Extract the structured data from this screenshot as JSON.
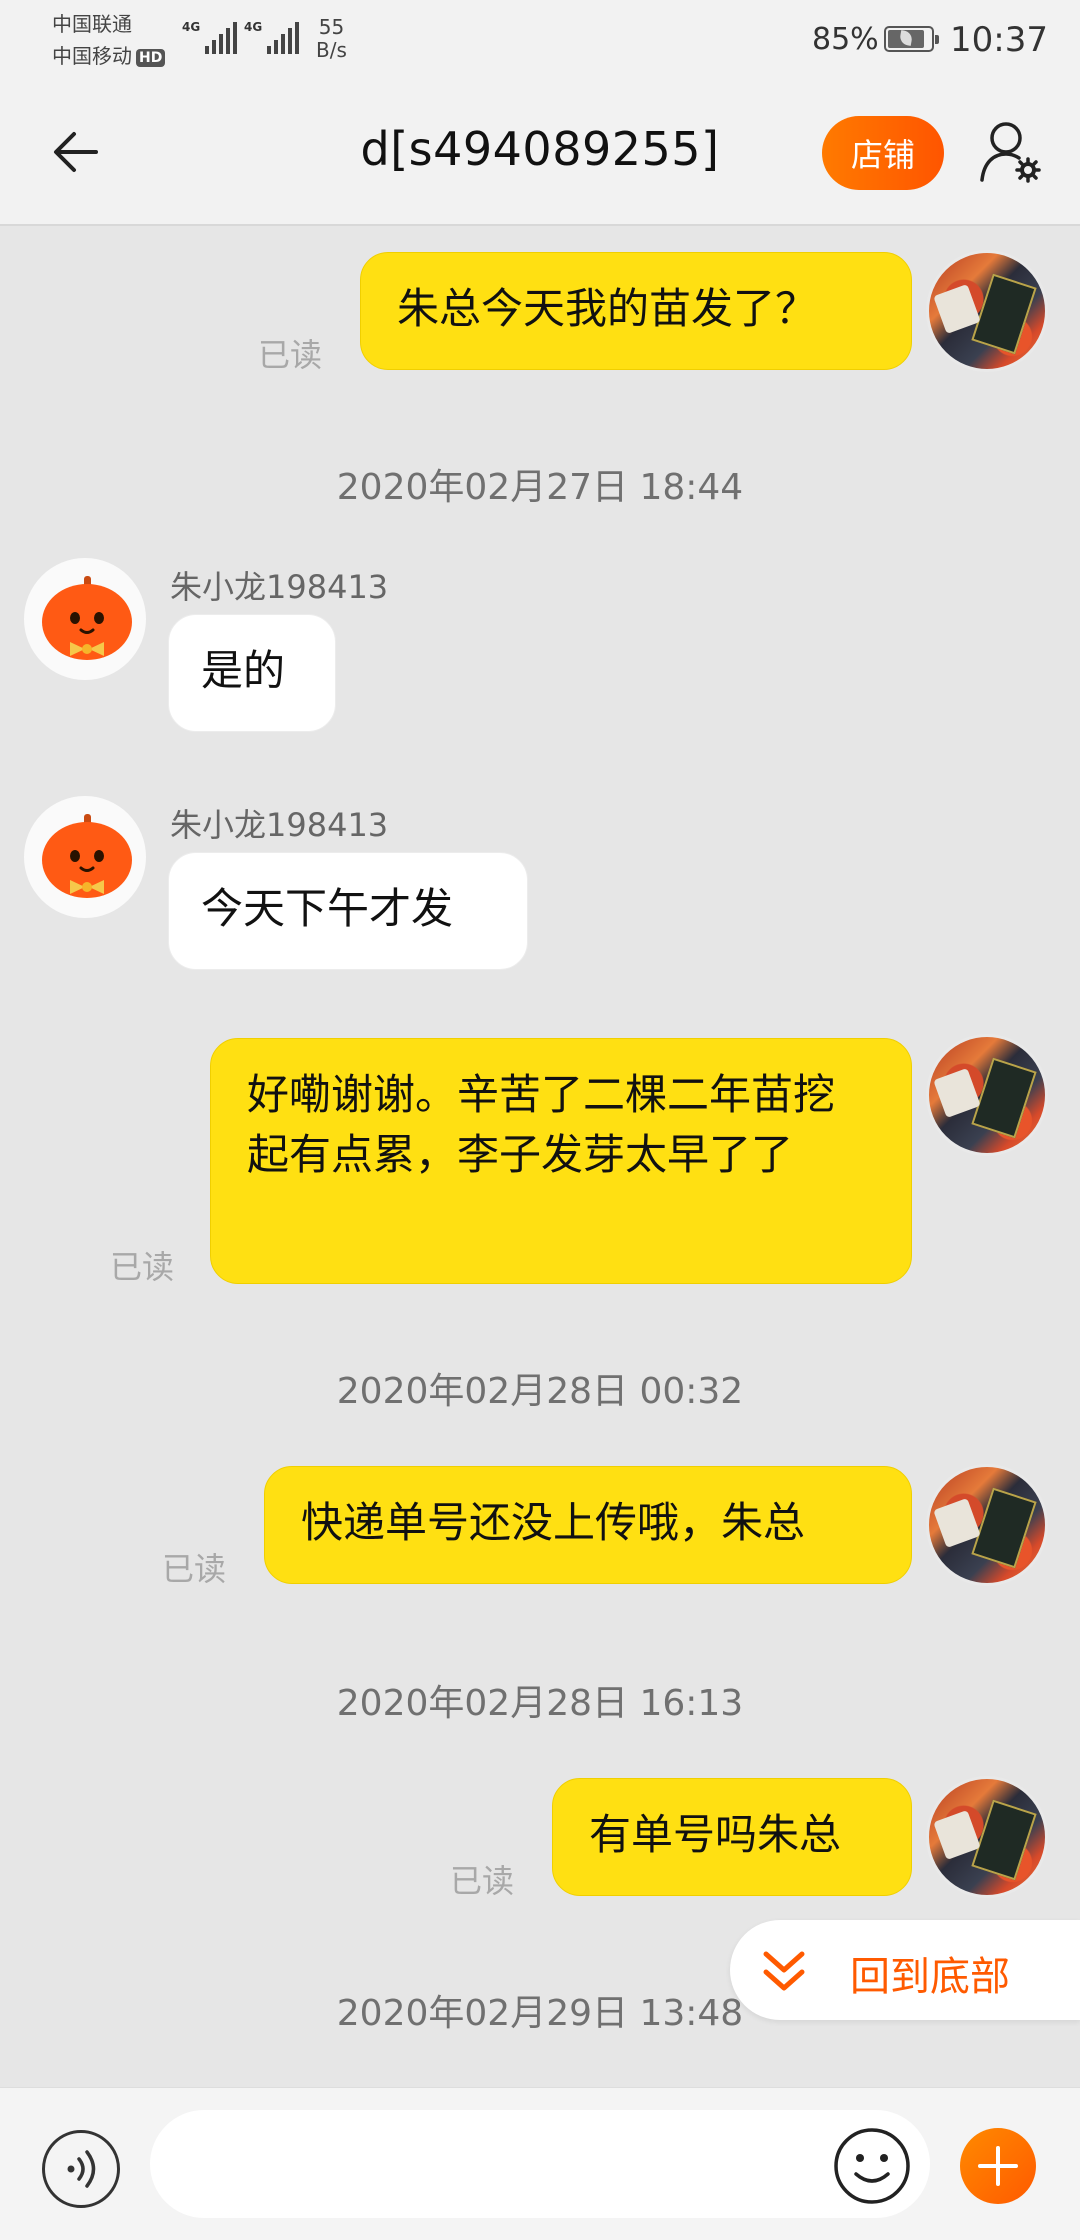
{
  "status_bar": {
    "carrier_1": "中国联通",
    "carrier_2": "中国移动",
    "hd_badge": "HD",
    "signal_1_label": "4G",
    "signal_2_label": "4G",
    "net_speed_value": "55",
    "net_speed_unit": "B/s",
    "battery_percent": "85%",
    "time": "10:37"
  },
  "header": {
    "title": "d[s494089255]",
    "shop_button": "店铺",
    "back_icon": "arrow-left-icon",
    "settings_icon": "user-settings-icon"
  },
  "chat": {
    "messages": [
      {
        "from": "me",
        "text": "朱总今天我的苗发了？",
        "status": "已读"
      },
      {
        "timestamp": "2020年02月27日 18:44"
      },
      {
        "from": "other",
        "nickname": "朱小龙198413",
        "text": "是的"
      },
      {
        "from": "other",
        "nickname": "朱小龙198413",
        "text": "今天下午才发"
      },
      {
        "from": "me",
        "text": "好嘞谢谢。辛苦了二棵二年苗挖起有点累，李子发芽太早了了",
        "status": "已读"
      },
      {
        "timestamp": "2020年02月28日 00:32"
      },
      {
        "from": "me",
        "text": "快递单号还没上传哦，朱总",
        "status": "已读"
      },
      {
        "timestamp": "2020年02月28日 16:13"
      },
      {
        "from": "me",
        "text": "有单号吗朱总",
        "status": "已读"
      },
      {
        "timestamp": "2020年02月29日 13:48"
      }
    ]
  },
  "back_to_bottom": {
    "label": "回到底部"
  },
  "input_bar": {
    "placeholder": "",
    "voice_icon": "voice-icon",
    "emoji_icon": "emoji-icon",
    "plus_icon": "plus-icon"
  },
  "colors": {
    "accent": "#ff5a00",
    "my_bubble": "#ffe012",
    "other_bubble": "#ffffff",
    "background": "#e6e6e6"
  }
}
